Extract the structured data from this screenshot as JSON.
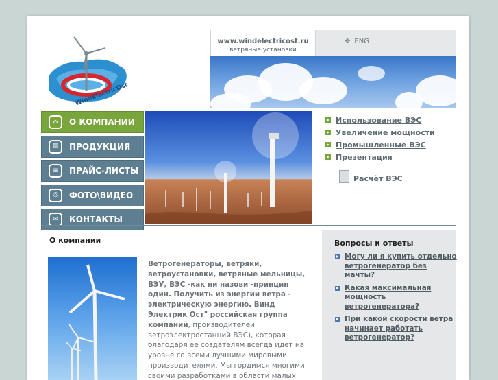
{
  "header": {
    "site_url": "www.windelectricost.ru",
    "tagline": "ветряные установки",
    "lang": "ENG",
    "logo_text": "WindElectricOst"
  },
  "nav": {
    "items": [
      {
        "label": "О КОМПАНИИ",
        "icon": "home-icon"
      },
      {
        "label": "ПРОДУКЦИЯ",
        "icon": "product-icon"
      },
      {
        "label": "ПРАЙС-ЛИСТЫ",
        "icon": "document-icon"
      },
      {
        "label": "ФОТО\\ВИДЕО",
        "icon": "camera-icon"
      },
      {
        "label": "КОНТАКТЫ",
        "icon": "mail-icon"
      }
    ],
    "active_index": 0
  },
  "links": {
    "items": [
      "Использование ВЭС",
      "Увеличение мощности",
      "Промышленные ВЭС",
      "Презентация"
    ],
    "calc_label": "Расчёт ВЭС"
  },
  "about": {
    "title": "О компании",
    "text_bold": "Ветрогенераторы, ветряки, ветроустановки, ветряные мельницы, ВЭУ, ВЭС  -как ни назови  -принцип один. Получить из энергии ветра   - электрическую энергию.  Винд Электрик Ост\"   российская группа компаний",
    "text_regular": ", производителей ветроэлектростанций  ВЭС), которая благодаря ее создателям всегда идет на уровне со всеми лучшими мировыми производителями. Мы гордимся многими своими разработками в области малых"
  },
  "faq": {
    "title": "Вопросы и ответы",
    "items": [
      "Могу ли я купить отдельно ветрогенератор без мачты?",
      "Какая максимальная мощность ветрогенератора?",
      "При какой скорости ветра начинает работать ветрогенератор?"
    ]
  },
  "colors": {
    "nav_active": "#79a63c",
    "nav_default": "#5e7e91",
    "link_bullet": "#79a63c",
    "faq_bullet": "#4b79b5",
    "background": "#c9d6d4"
  }
}
